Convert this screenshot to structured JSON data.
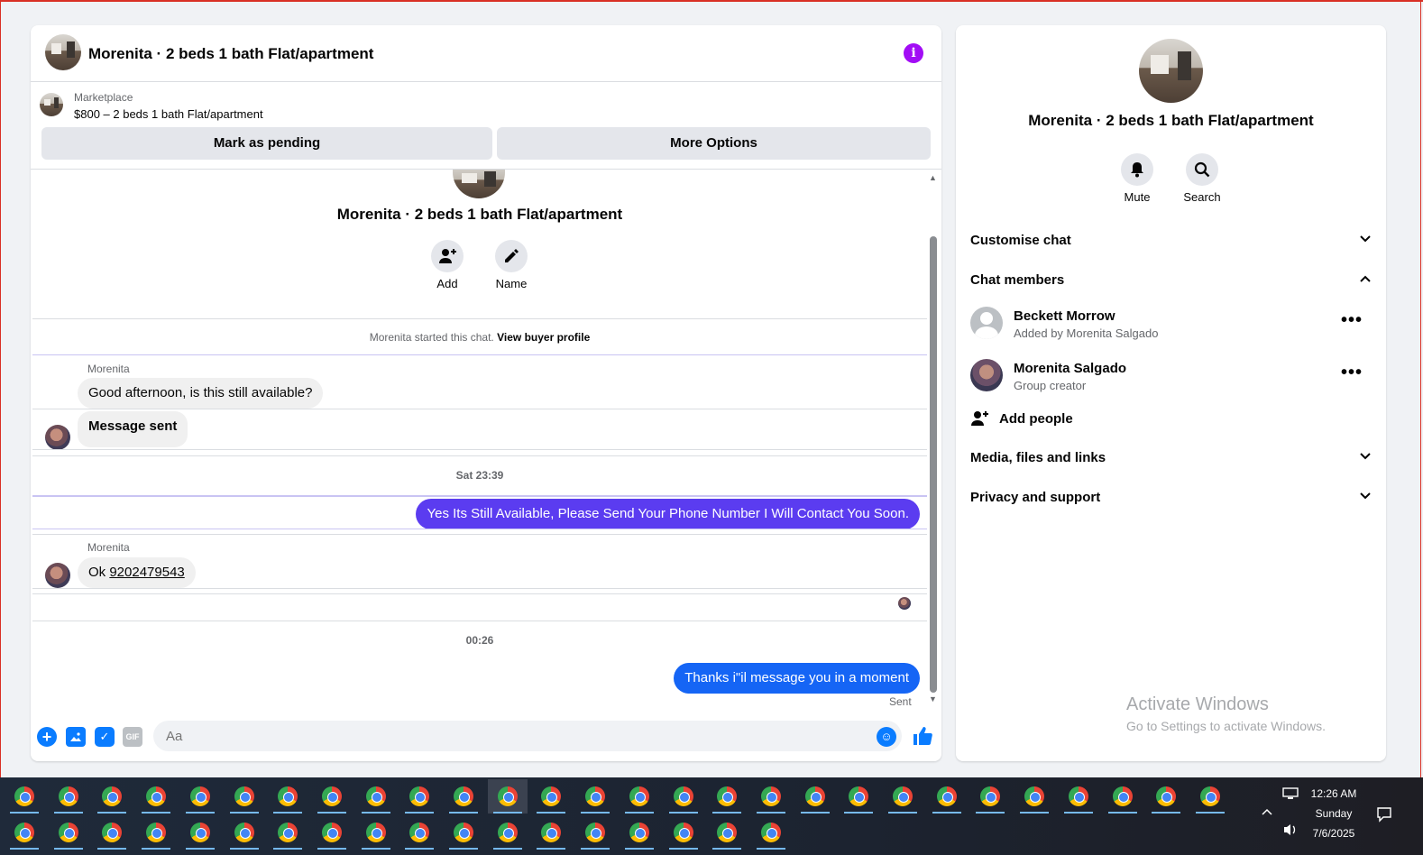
{
  "colors": {
    "accent_blue": "#0a7cff",
    "outgoing_purple": "#5b3cf0",
    "outgoing_blue": "#1565f5",
    "info_purple": "#a20df5",
    "page_bg": "#f0f2f5"
  },
  "header": {
    "title": "Morenita · 2 beds 1 bath Flat/apartment",
    "info_icon": "info-icon"
  },
  "marketplace": {
    "label": "Marketplace",
    "price_line": "$800 – 2 beds 1 bath Flat/apartment",
    "mark_pending": "Mark as pending",
    "more_options": "More Options"
  },
  "conversation": {
    "title": "Morenita · 2 beds 1 bath Flat/apartment",
    "add_label": "Add",
    "name_label": "Name",
    "started_text": "Morenita started this chat.",
    "view_profile": "View buyer profile",
    "messages": [
      {
        "sender": "Morenita",
        "text": "Good afternoon, is this still available?"
      },
      {
        "text": "Message sent"
      },
      {
        "time": "Sat 23:39"
      },
      {
        "text": "Yes Its Still Available, Please Send Your Phone Number I Will Contact You Soon."
      },
      {
        "sender": "Morenita",
        "text_prefix": "Ok ",
        "phone": "9202479543"
      },
      {
        "time": "00:26"
      },
      {
        "text": "Thanks i\"il message you in a moment",
        "status": "Sent"
      }
    ]
  },
  "composer": {
    "placeholder": "Aa",
    "icons": [
      "plus-icon",
      "photo-icon",
      "sticker-icon",
      "gif-icon",
      "emoji-icon",
      "like-icon"
    ],
    "gif_label": "GIF"
  },
  "info": {
    "title": "Morenita · 2 beds 1 bath Flat/apartment",
    "mute_label": "Mute",
    "search_label": "Search",
    "sections": {
      "customise": "Customise chat",
      "members": "Chat members",
      "media": "Media, files and links",
      "privacy": "Privacy and support"
    },
    "members": [
      {
        "name": "Beckett Morrow",
        "sub": "Added by Morenita Salgado"
      },
      {
        "name": "Morenita Salgado",
        "sub": "Group creator"
      }
    ],
    "add_people": "Add people"
  },
  "watermark": {
    "line1": "Activate Windows",
    "line2": "Go to Settings to activate Windows."
  },
  "taskbar": {
    "time": "12:26 AM",
    "day": "Sunday",
    "date": "7/6/2025"
  }
}
